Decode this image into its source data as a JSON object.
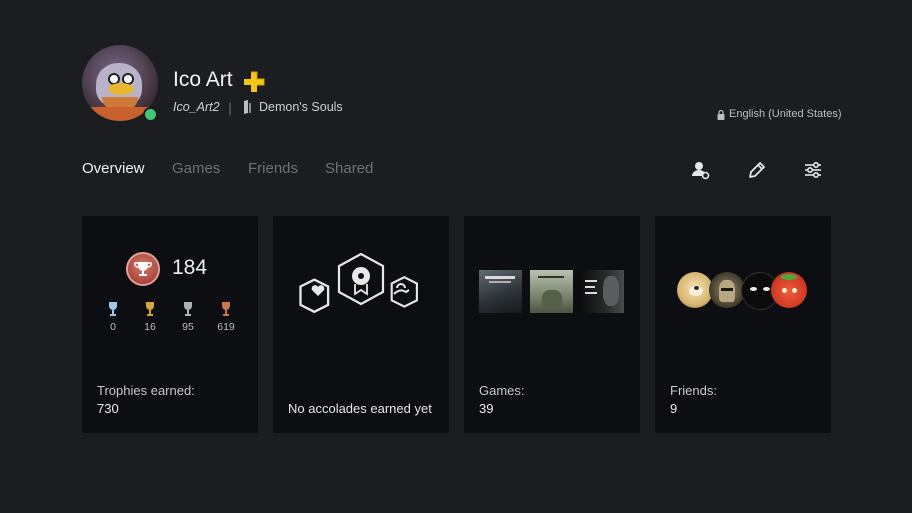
{
  "profile": {
    "name": "Ico Art",
    "online_id": "Ico_Art2",
    "separator": "|",
    "now_playing": "Demon's Souls",
    "language": "English (United States)",
    "status": "online",
    "plus_color": "#f5c518"
  },
  "tabs": [
    {
      "label": "Overview",
      "active": true
    },
    {
      "label": "Games",
      "active": false
    },
    {
      "label": "Friends",
      "active": false
    },
    {
      "label": "Shared",
      "active": false
    }
  ],
  "actions": [
    {
      "icon": "add-friend-icon"
    },
    {
      "icon": "edit-pencil-icon"
    },
    {
      "icon": "settings-sliders-icon"
    }
  ],
  "cards": {
    "trophies": {
      "level": "184",
      "counts": {
        "platinum": "0",
        "gold": "16",
        "silver": "95",
        "bronze": "619"
      },
      "label": "Trophies earned:",
      "value": "730"
    },
    "accolades": {
      "label": "No accolades earned yet",
      "icons": [
        "heart-hex-icon",
        "badge-hex-icon",
        "hand-hex-icon"
      ]
    },
    "games": {
      "label": "Games:",
      "value": "39",
      "thumbnails": [
        "Demon's Souls",
        "The Last Guardian",
        "The Last of Us Part II"
      ]
    },
    "friends": {
      "label": "Friends:",
      "value": "9",
      "avatars": [
        "dog-avatar",
        "knight-avatar",
        "cat-avatar",
        "strawberry-avatar"
      ]
    }
  }
}
